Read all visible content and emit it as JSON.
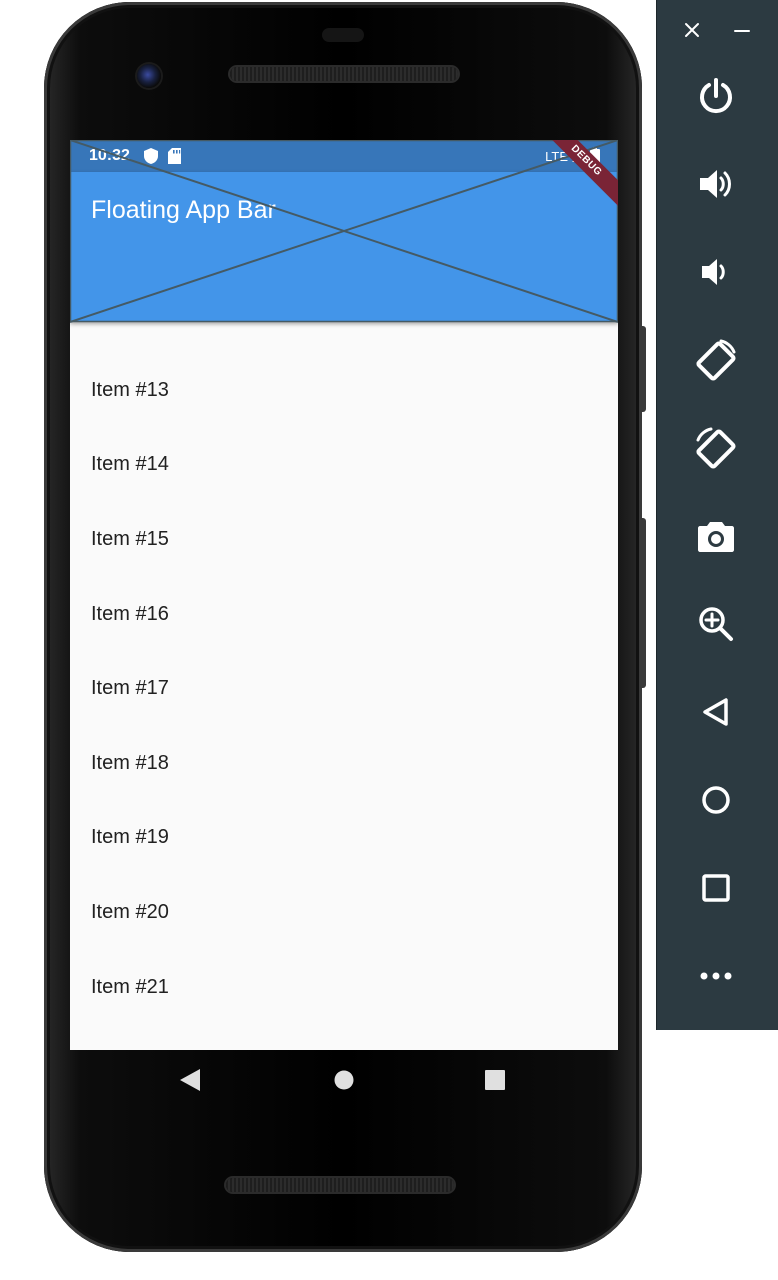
{
  "status_bar": {
    "time": "10:32",
    "network": "LTE",
    "icons": [
      "shield-icon",
      "sd-card-icon",
      "signal-icon",
      "battery-icon"
    ]
  },
  "app_bar": {
    "title": "Floating App Bar",
    "background": "#4395e9",
    "status_background": "#3776b9"
  },
  "debug_banner": {
    "label": "DEBUG",
    "color": "#7a2436"
  },
  "list": {
    "items": [
      "Item #13",
      "Item #14",
      "Item #15",
      "Item #16",
      "Item #17",
      "Item #18",
      "Item #19",
      "Item #20",
      "Item #21"
    ]
  },
  "nav_bar": {
    "buttons": [
      "back-icon",
      "home-icon",
      "overview-icon"
    ]
  },
  "emulator_toolbar": {
    "background": "#2c3a41",
    "window_controls": [
      "close-icon",
      "minimize-icon"
    ],
    "buttons": [
      "power-icon",
      "volume-up-icon",
      "volume-down-icon",
      "rotate-left-icon",
      "rotate-right-icon",
      "camera-icon",
      "zoom-icon",
      "back-icon",
      "home-icon",
      "overview-icon",
      "more-icon"
    ]
  }
}
